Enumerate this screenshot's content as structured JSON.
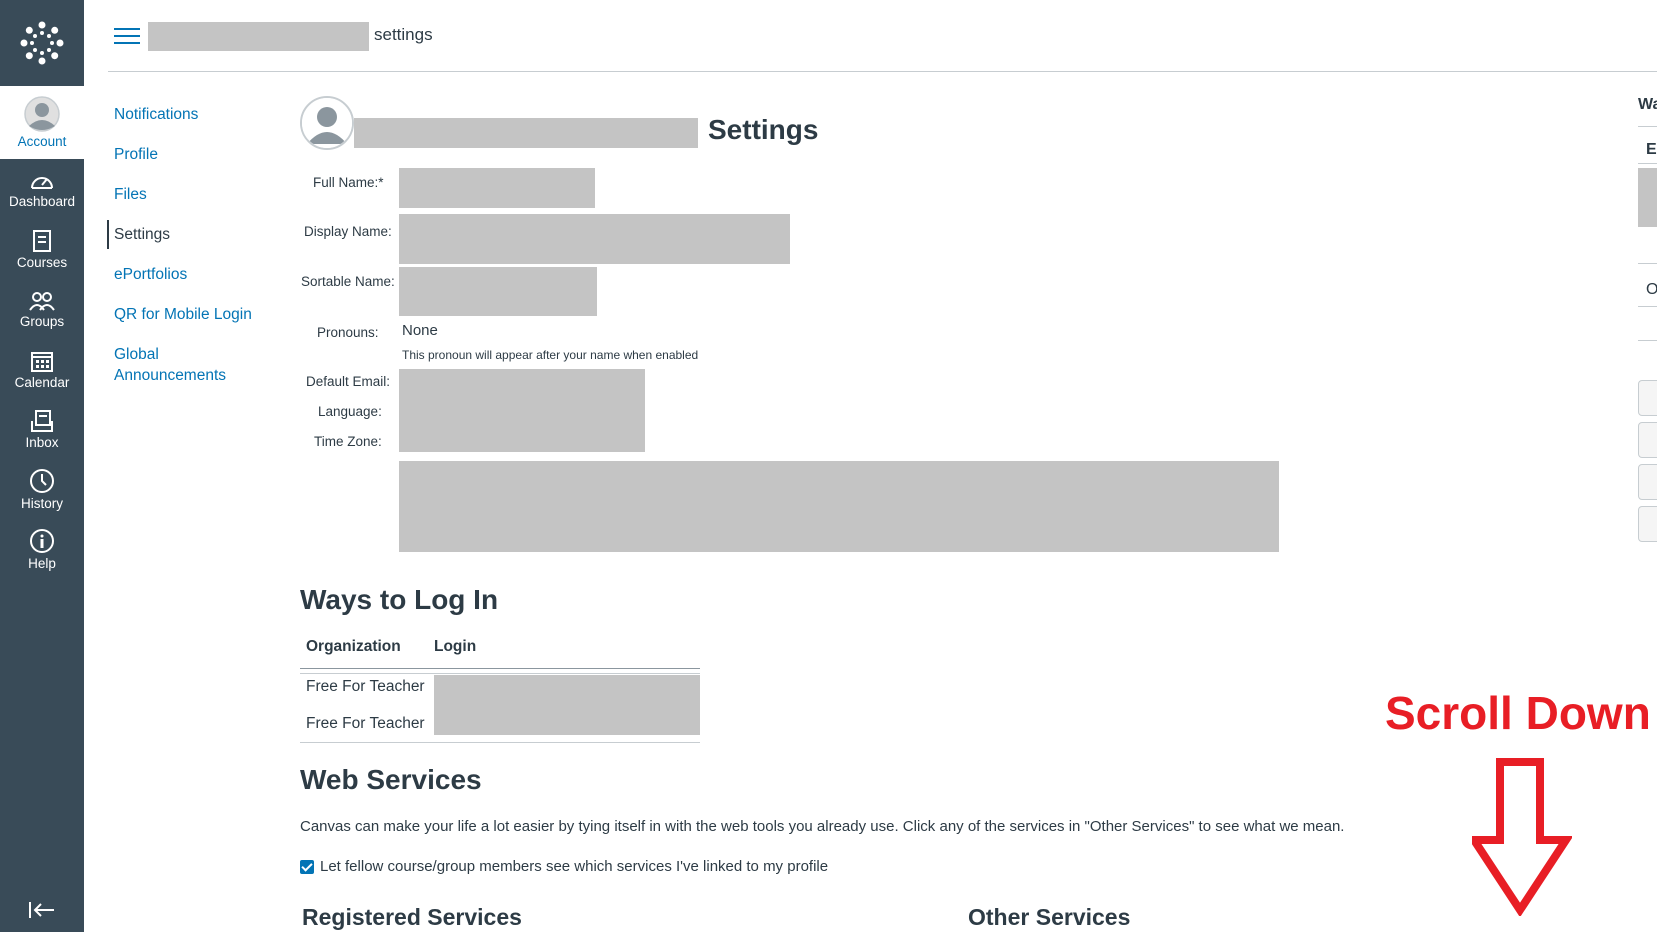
{
  "nav": {
    "account_label": "Account",
    "items": [
      {
        "label": "Dashboard",
        "icon": "dashboard-icon"
      },
      {
        "label": "Courses",
        "icon": "courses-icon"
      },
      {
        "label": "Groups",
        "icon": "groups-icon"
      },
      {
        "label": "Calendar",
        "icon": "calendar-icon"
      },
      {
        "label": "Inbox",
        "icon": "inbox-icon"
      },
      {
        "label": "History",
        "icon": "history-icon"
      },
      {
        "label": "Help",
        "icon": "help-icon"
      }
    ]
  },
  "breadcrumb": {
    "current": "settings"
  },
  "left_menu": {
    "items": [
      {
        "label": "Notifications"
      },
      {
        "label": "Profile"
      },
      {
        "label": "Files"
      },
      {
        "label": "Settings"
      },
      {
        "label": "ePortfolios"
      },
      {
        "label": "QR for Mobile Login"
      },
      {
        "label": "Global Announcements"
      }
    ]
  },
  "settings": {
    "title": "Settings",
    "labels": {
      "full_name": "Full Name:*",
      "display_name": "Display Name:",
      "sortable_name": "Sortable Name:",
      "pronouns": "Pronouns:",
      "default_email": "Default Email:",
      "language": "Language:",
      "time_zone": "Time Zone:"
    },
    "pronouns_value": "None",
    "pronouns_hint": "This pronoun will appear after your name when enabled"
  },
  "ways_to_log_in": {
    "title": "Ways to Log In",
    "columns": [
      "Organization",
      "Login"
    ],
    "rows": [
      {
        "organization": "Free For Teacher"
      },
      {
        "organization": "Free For Teacher"
      }
    ]
  },
  "web_services": {
    "title": "Web Services",
    "description": "Canvas can make your life a lot easier by tying itself in with the web tools you already use. Click any of the services in \"Other Services\" to see what we mean.",
    "checkbox_label": "Let fellow course/group members see which services I've linked to my profile",
    "checkbox_checked": true,
    "registered_title": "Registered Services",
    "other_title": "Other Services"
  },
  "right_panel": {
    "title_fragment": "Wa",
    "item1_fragment": "E",
    "item2_fragment": "O"
  },
  "annotation": {
    "text": "Scroll Down",
    "color": "#e81e25"
  },
  "colors": {
    "nav_bg": "#394b58",
    "link": "#0374b5",
    "redaction": "#c4c4c4"
  }
}
